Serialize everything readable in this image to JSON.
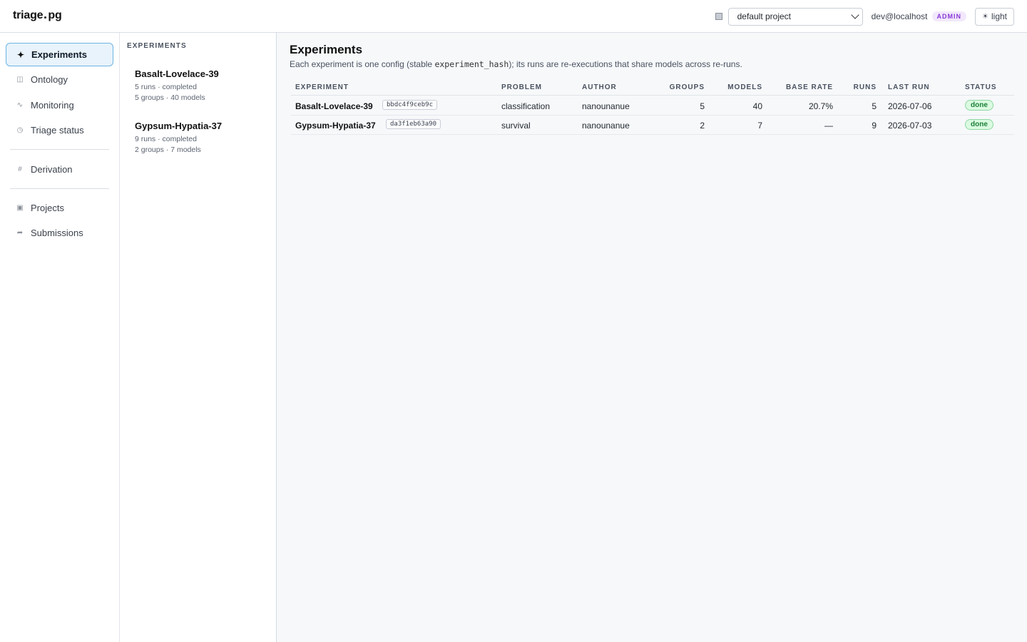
{
  "app": {
    "brand_left": "triage",
    "brand_right": "pg",
    "project_select": {
      "value": "default project"
    },
    "user": "dev@localhost",
    "role_badge": "ADMIN",
    "theme_toggle": {
      "icon": "sun-icon",
      "label": "light"
    }
  },
  "sidebar": {
    "items": [
      {
        "label": "Experiments",
        "icon": "sparkle-icon",
        "glyph": "✦",
        "active": true
      },
      {
        "label": "Ontology",
        "icon": "book-icon",
        "glyph": "◫"
      },
      {
        "label": "Monitoring",
        "icon": "pulse-icon",
        "glyph": "∿"
      },
      {
        "label": "Triage status",
        "icon": "clock-icon",
        "glyph": "◷"
      },
      {
        "label": "Derivation",
        "icon": "hash-icon",
        "glyph": "#"
      },
      {
        "label": "Projects",
        "icon": "folder-icon",
        "glyph": "▣"
      },
      {
        "label": "Submissions",
        "icon": "send-icon",
        "glyph": "➦"
      }
    ]
  },
  "list": {
    "heading": "EXPERIMENTS",
    "items": [
      {
        "name": "Basalt-Lovelace-39",
        "line1": "5 runs · completed",
        "line2": "5 groups · 40 models"
      },
      {
        "name": "Gypsum-Hypatia-37",
        "line1": "9 runs · completed",
        "line2": "2 groups · 7 models"
      }
    ]
  },
  "main": {
    "title": "Experiments",
    "subtitle_pre": "Each experiment is one config (stable ",
    "subtitle_code": "experiment_hash",
    "subtitle_post": "); its runs are re-executions that share models across re-runs.",
    "table": {
      "headers": {
        "experiment": "EXPERIMENT",
        "problem": "PROBLEM",
        "author": "AUTHOR",
        "groups": "GROUPS",
        "models": "MODELS",
        "base_rate": "BASE RATE",
        "runs": "RUNS",
        "last_run": "LAST RUN",
        "status": "STATUS"
      },
      "rows": [
        {
          "name": "Basalt-Lovelace-39",
          "hash": "bbdc4f9ceb9c",
          "problem": "classification",
          "author": "nanounanue",
          "groups": "5",
          "models": "40",
          "base_rate": "20.7%",
          "runs": "5",
          "last_run": "2026-07-06",
          "status": "done"
        },
        {
          "name": "Gypsum-Hypatia-37",
          "hash": "da3f1eb63a90",
          "problem": "survival",
          "author": "nanounanue",
          "groups": "2",
          "models": "7",
          "base_rate": "—",
          "runs": "9",
          "last_run": "2026-07-03",
          "status": "done"
        }
      ]
    }
  },
  "colors": {
    "accent_active_bg": "#e8f3fb",
    "accent_active_border": "#6db3e3",
    "status_done": "#1a7f37",
    "admin_badge": "#8a3ad6"
  }
}
